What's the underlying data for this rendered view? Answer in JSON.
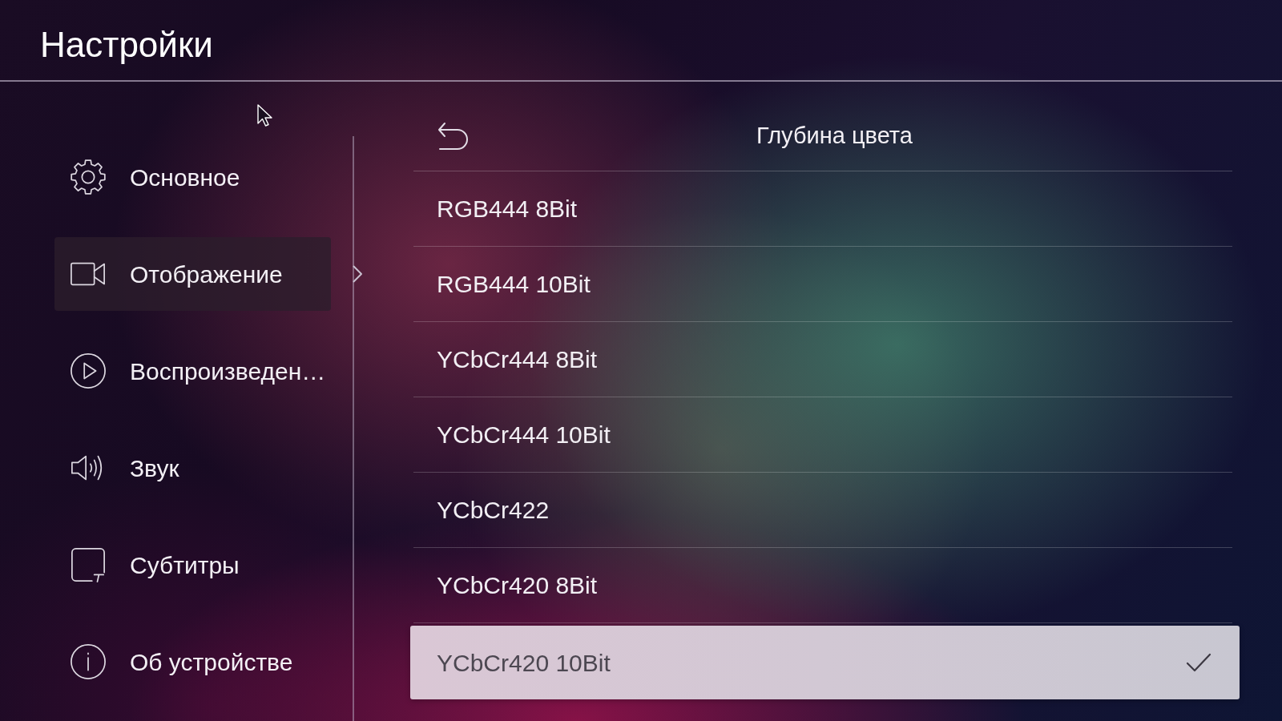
{
  "header": {
    "title": "Настройки"
  },
  "sidebar": {
    "items": [
      {
        "label": "Основное",
        "selected": false
      },
      {
        "label": "Отображение",
        "selected": true
      },
      {
        "label": "Воспроизведен…",
        "selected": false
      },
      {
        "label": "Звук",
        "selected": false
      },
      {
        "label": "Субтитры",
        "selected": false
      },
      {
        "label": "Об устройстве",
        "selected": false
      }
    ]
  },
  "panel": {
    "title": "Глубина цвета",
    "options": [
      {
        "label": "RGB444 8Bit",
        "selected": false,
        "checked": false
      },
      {
        "label": "RGB444 10Bit",
        "selected": false,
        "checked": false
      },
      {
        "label": "YCbCr444 8Bit",
        "selected": false,
        "checked": false
      },
      {
        "label": "YCbCr444 10Bit",
        "selected": false,
        "checked": false
      },
      {
        "label": "YCbCr422",
        "selected": false,
        "checked": false
      },
      {
        "label": "YCbCr420 8Bit",
        "selected": false,
        "checked": false
      },
      {
        "label": "YCbCr420 10Bit",
        "selected": true,
        "checked": true
      }
    ]
  }
}
